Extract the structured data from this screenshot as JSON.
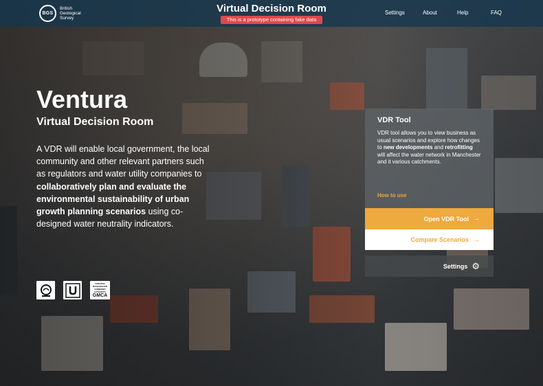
{
  "header": {
    "logo_mark": "BGS",
    "logo_text": [
      "British",
      "Geological",
      "Survey"
    ],
    "title": "Virtual Decision Room",
    "prototype_notice": "This is a prototype containing fake data",
    "nav": [
      "Settings",
      "About",
      "Help",
      "FAQ"
    ]
  },
  "hero": {
    "title": "Ventura",
    "subtitle": "Virtual Decision Room",
    "desc_1": "A VDR will enable local government, the local community and other relevant partners such as regulators and water utility companies to ",
    "desc_bold": "collaboratively plan and evaluate the environmental sustainability of urban growth planning scenarios",
    "desc_2": " using co-designed water neutrality indicators."
  },
  "partners": {
    "gmca_small": "GREATER MANCHESTER COMBINED AUTHORITY",
    "gmca_big": "GMCA"
  },
  "card": {
    "title": "VDR Tool",
    "body_1": "VDR tool allows you to view business as usual scenarios and explore how changes to ",
    "body_bold_1": "new developments",
    "body_2": " and ",
    "body_bold_2": "retrofitting",
    "body_3": " will affect the water network in Manchester and it various catchments.",
    "link": "How to use",
    "open_label": "Open VDR Tool",
    "compare_label": "Compare Scenarios",
    "settings_label": "Settings"
  },
  "colors": {
    "header_bg": "#14374f",
    "accent": "#eea93f",
    "prototype_badge": "#e0484c"
  },
  "icons": [
    "bgs-logo-icon",
    "environment-agency-logo-icon",
    "united-utilities-logo-icon",
    "arrow-right-icon",
    "gear-icon"
  ]
}
